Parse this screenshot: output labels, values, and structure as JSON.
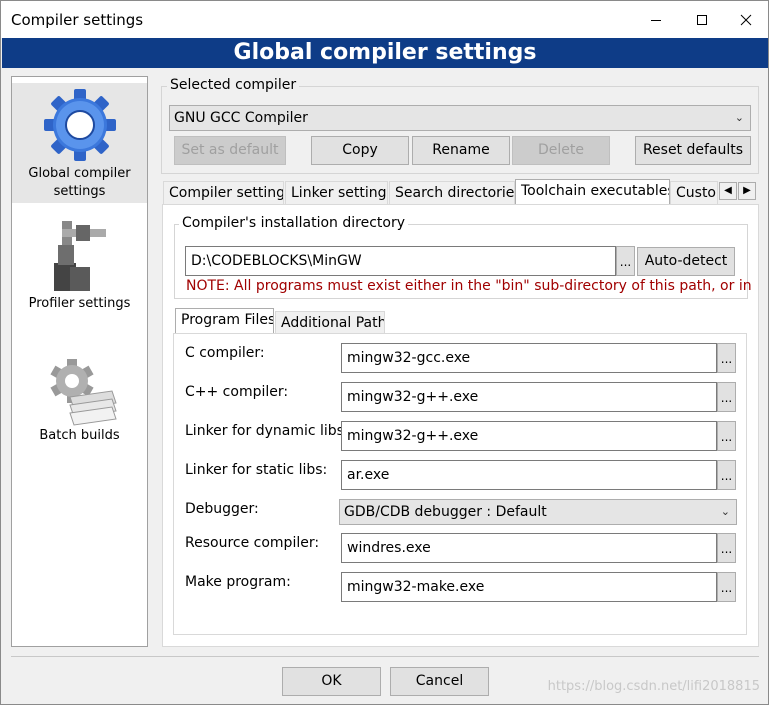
{
  "window": {
    "title": "Compiler settings"
  },
  "title_controls": [
    "minimize-icon",
    "maximize-icon",
    "close-icon"
  ],
  "banner": "Global compiler settings",
  "sidebar": {
    "items": [
      {
        "label_line1": "Global compiler",
        "label_line2": "settings",
        "icon": "gear-icon",
        "selected": true
      },
      {
        "label_line1": "Profiler settings",
        "label_line2": "",
        "icon": "caliper-icon",
        "selected": false
      },
      {
        "label_line1": "Batch builds",
        "label_line2": "",
        "icon": "gear-stack-icon",
        "selected": false
      }
    ]
  },
  "selected_compiler": {
    "label": "Selected compiler",
    "value": "GNU GCC Compiler",
    "buttons": {
      "set_default": "Set as default",
      "copy": "Copy",
      "rename": "Rename",
      "delete": "Delete",
      "reset": "Reset defaults"
    }
  },
  "tabs": [
    "Compiler settings",
    "Linker settings",
    "Search directories",
    "Toolchain executables",
    "Custor"
  ],
  "active_tab": "Toolchain executables",
  "install_dir": {
    "label": "Compiler's installation directory",
    "value": "D:\\CODEBLOCKS\\MinGW",
    "browse": "...",
    "autodetect": "Auto-detect",
    "note": "NOTE: All programs must exist either in the \"bin\" sub-directory of this path, or in"
  },
  "subtabs": [
    "Program Files",
    "Additional Paths"
  ],
  "programs": [
    {
      "label": "C compiler:",
      "value": "mingw32-gcc.exe"
    },
    {
      "label": "C++ compiler:",
      "value": "mingw32-g++.exe"
    },
    {
      "label": "Linker for dynamic libs:",
      "value": "mingw32-g++.exe"
    },
    {
      "label": "Linker for static libs:",
      "value": "ar.exe"
    },
    {
      "label": "Debugger:",
      "value": "GDB/CDB debugger : Default"
    },
    {
      "label": "Resource compiler:",
      "value": "windres.exe"
    },
    {
      "label": "Make program:",
      "value": "mingw32-make.exe"
    }
  ],
  "browse_label": "...",
  "footer": {
    "ok": "OK",
    "cancel": "Cancel",
    "watermark": "https://blog.csdn.net/lifi2018815"
  },
  "colors": {
    "banner_bg": "#0e3c87",
    "note_text": "#a00000"
  }
}
